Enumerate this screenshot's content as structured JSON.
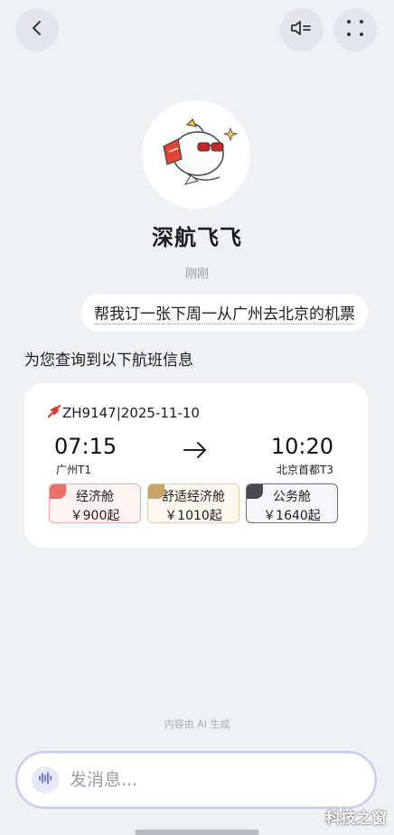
{
  "header": {
    "back_icon": "chevron-left-icon",
    "speaker_icon": "speaker-settings-icon",
    "menu_icon": "four-dots-icon"
  },
  "bot": {
    "name": "深航飞飞",
    "avatar_icon": "plane-mascot-icon"
  },
  "chat": {
    "timestamp": "刚刚",
    "user_message": "帮我订一张下周一从广州去北京的机票",
    "bot_reply": "为您查询到以下航班信息"
  },
  "flight": {
    "header": "ZH9147|2025-11-10",
    "departure_time": "07:15",
    "departure_airport": "广州T1",
    "arrival_time": "10:20",
    "arrival_airport": "北京首都T3",
    "cabins": [
      {
        "name": "经济舱",
        "price": "￥900起",
        "color": "#e8706a"
      },
      {
        "name": "舒适经济舱",
        "price": "￥1010起",
        "color": "#c9a46a"
      },
      {
        "name": "公务舱",
        "price": "￥1640起",
        "color": "#4a4b52"
      }
    ]
  },
  "footer": {
    "ai_note": "内容由 AI 生成",
    "input_placeholder": "发消息...",
    "watermark": "科技之窗"
  },
  "colors": {
    "background": "#eff1f5",
    "card": "#ffffff",
    "accent_input_border": "#c9c6f2"
  }
}
